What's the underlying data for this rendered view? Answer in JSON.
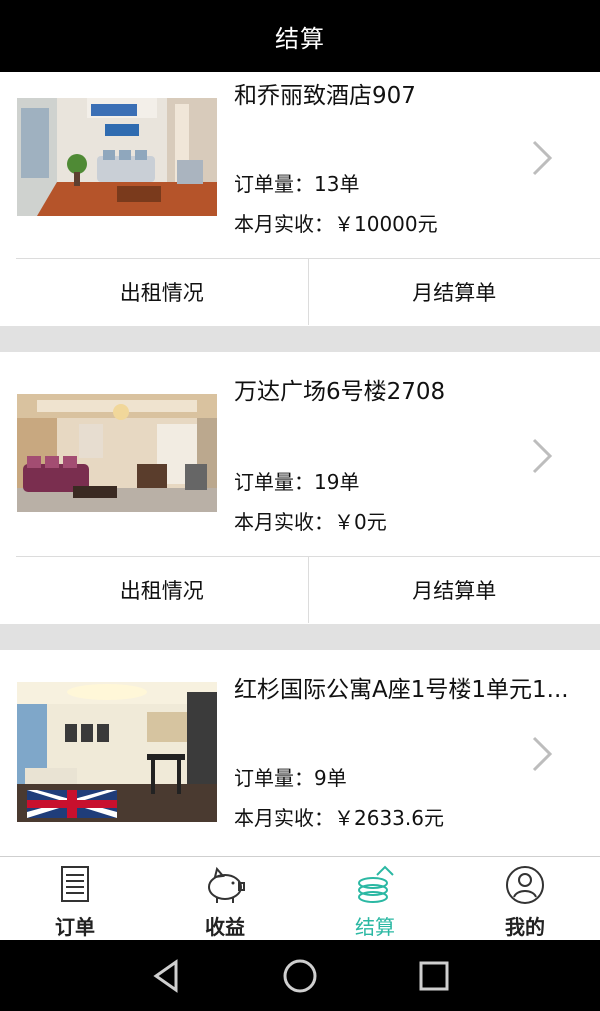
{
  "header": {
    "title": "结算"
  },
  "cards": [
    {
      "title": "和乔丽致酒店907",
      "orders": "订单量：13单",
      "income": "本月实收：￥10000元",
      "btn_rent": "出租情况",
      "btn_monthly": "月结算单"
    },
    {
      "title": "万达广场6号楼2708",
      "orders": "订单量：19单",
      "income": "本月实收：￥0元",
      "btn_rent": "出租情况",
      "btn_monthly": "月结算单"
    },
    {
      "title": "红杉国际公寓A座1号楼1单元1...",
      "orders": "订单量：9单",
      "income": "本月实收：￥2633.6元"
    }
  ],
  "tabs": [
    {
      "label": "订单",
      "icon": "order-list-icon"
    },
    {
      "label": "收益",
      "icon": "piggy-bank-icon"
    },
    {
      "label": "结算",
      "icon": "settlement-coins-icon",
      "active": true
    },
    {
      "label": "我的",
      "icon": "user-icon"
    }
  ],
  "colors": {
    "accent": "#2bb8a3",
    "topbar": "#000000",
    "separator": "#e1e1e1"
  }
}
